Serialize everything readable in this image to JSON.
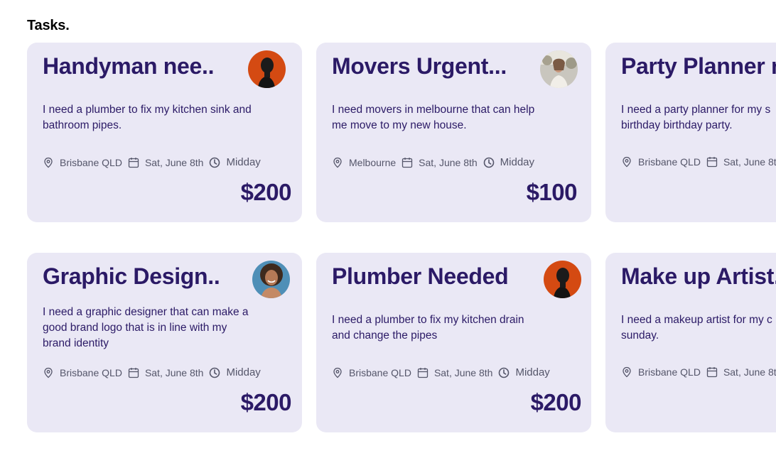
{
  "page": {
    "heading": "Tasks."
  },
  "colors": {
    "card_bg": "#EAE8F5",
    "title": "#2B1A66",
    "meta": "#55566A"
  },
  "tasks": [
    {
      "title": "Handyman nee..",
      "description": "I need a plumber to fix my kitchen sink and bathroom pipes.",
      "location": "Brisbane QLD",
      "date": "Sat, June 8th",
      "time": "Midday",
      "price": "$200",
      "avatar": "avatar-dark-portrait-orange-bg"
    },
    {
      "title": "Movers Urgent...",
      "description": "I need movers in melbourne that can help me move to my new house.",
      "location": "Melbourne",
      "date": "Sat, June 8th",
      "time": "Midday",
      "price": "$100",
      "avatar": "avatar-outdoor-photo"
    },
    {
      "title": "Party Planner n",
      "description": "I need a party planner for my s birthday birthday party.",
      "location": "Brisbane QLD",
      "date": "Sat, June 8t",
      "time": "",
      "price": "",
      "avatar": ""
    },
    {
      "title": "Graphic Design..",
      "description": "I need a graphic designer that can make a good brand logo that is in line with my brand identity",
      "location": "Brisbane QLD",
      "date": "Sat, June 8th",
      "time": "Midday",
      "price": "$200",
      "avatar": "avatar-smiling-portrait-blue-bg"
    },
    {
      "title": "Plumber Needed",
      "description": "I need a plumber to fix my kitchen drain and change the pipes",
      "location": "Brisbane QLD",
      "date": "Sat, June 8th",
      "time": "Midday",
      "price": "$200",
      "avatar": "avatar-dark-portrait-orange-bg"
    },
    {
      "title": "Make up Artist.",
      "description": "I need a makeup artist for my c sunday.",
      "location": "Brisbane QLD",
      "date": "Sat, June 8t",
      "time": "",
      "price": "",
      "avatar": ""
    }
  ]
}
